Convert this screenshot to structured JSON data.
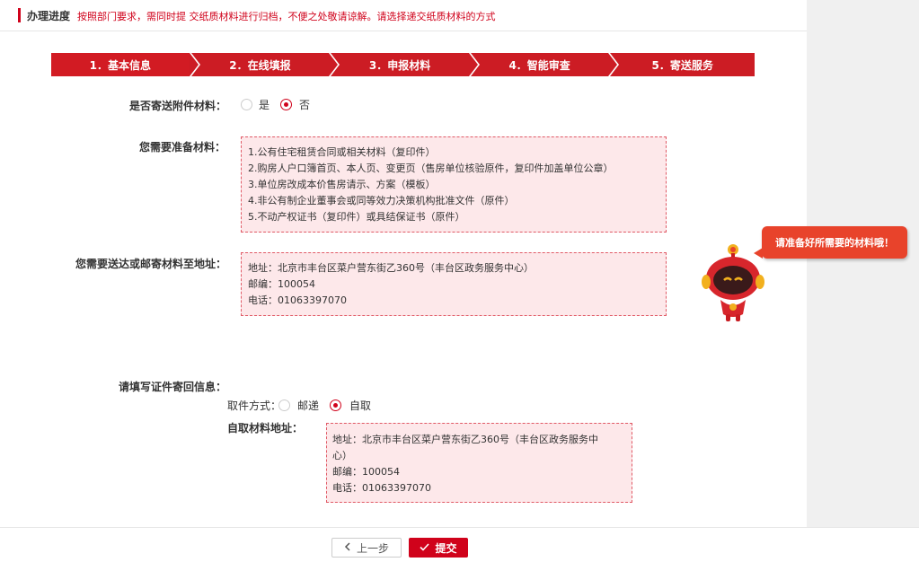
{
  "notice": {
    "title": "办理进度",
    "message": "按照部门要求，需同时提 交纸质材料进行归档，不便之处敬请谅解。请选择递交纸质材料的方式"
  },
  "steps": [
    {
      "label": "1．基本信息"
    },
    {
      "label": "2．在线填报"
    },
    {
      "label": "3．申报材料"
    },
    {
      "label": "4．智能审查"
    },
    {
      "label": "5．寄送服务"
    }
  ],
  "send_attachments": {
    "label": "是否寄送附件材料：",
    "options": [
      "是",
      "否"
    ],
    "selected": "否"
  },
  "materials": {
    "label": "您需要准备材料：",
    "items": [
      "1.公有住宅租赁合同或相关材料（复印件）",
      "2.购房人户口簿首页、本人页、变更页（售房单位核验原件，复印件加盖单位公章）",
      "3.单位房改成本价售房请示、方案（模板）",
      "4.非公有制企业董事会或同等效力决策机构批准文件（原件）",
      "5.不动产权证书（复印件）或具结保证书（原件）"
    ]
  },
  "mail_address": {
    "label": "您需要送达或邮寄材料至地址：",
    "lines": [
      "地址：北京市丰台区菜户营东街乙360号（丰台区政务服务中心）",
      "邮编：100054",
      "电话：01063397070"
    ]
  },
  "return_info": {
    "label": "请填写证件寄回信息：",
    "pickup_label": "取件方式：",
    "options": [
      "邮递",
      "自取"
    ],
    "selected": "自取",
    "self_pickup_label": "自取材料地址：",
    "lines": [
      "地址：北京市丰台区菜户营东街乙360号（丰台区政务服务中",
      "心）",
      "邮编：100054",
      "电话：01063397070"
    ]
  },
  "assistant": {
    "bubble": "请准备好所需要的材料哦！"
  },
  "footer": {
    "prev_label": "上一步",
    "submit_label": "提交"
  },
  "colors": {
    "accent": "#d0021b",
    "box_bg": "#fde8ea",
    "box_border": "#e05a66",
    "bubble": "#e8432b"
  },
  "icons": {
    "prev": "chevron-left-icon",
    "submit": "check-icon",
    "assistant": "robot-mascot"
  }
}
